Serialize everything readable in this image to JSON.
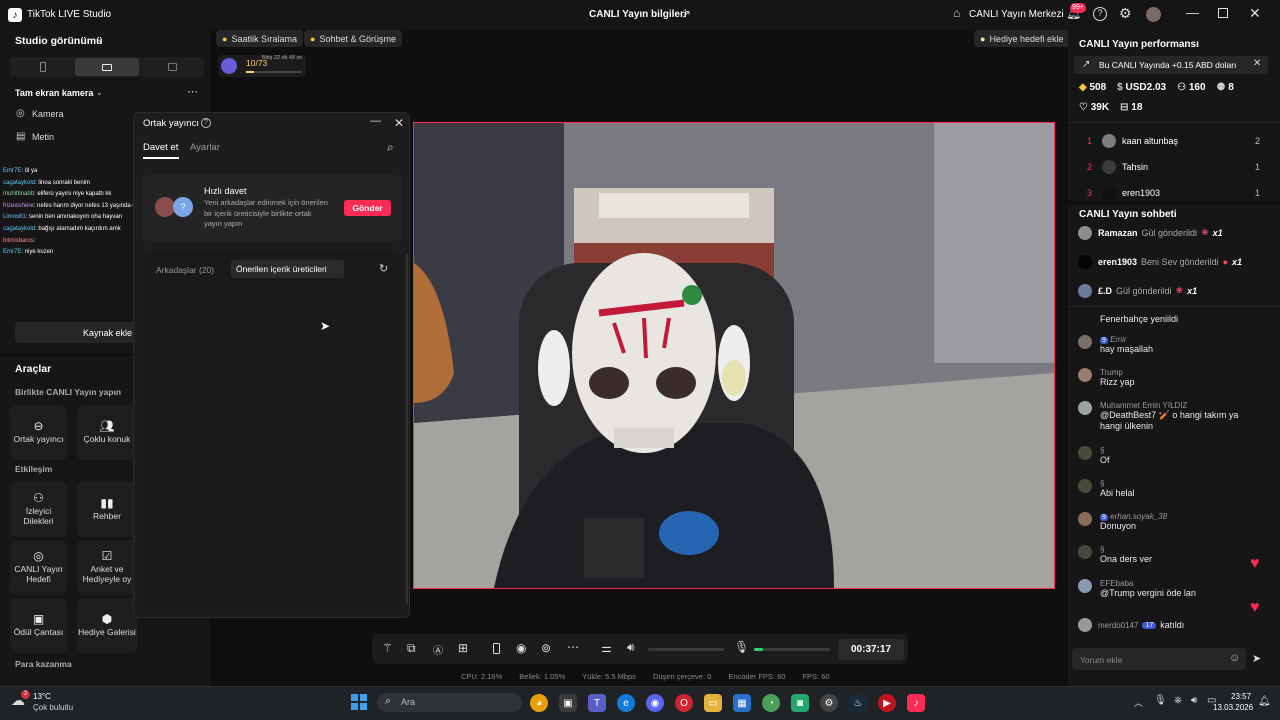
{
  "titlebar": {
    "app": "TikTok LIVE Studio",
    "center": "CANLI Yayın bilgileri",
    "center_link": "CANLI Yayın Merkezi",
    "badge": "99+"
  },
  "left": {
    "studio_view": "Studio görünümü",
    "fullscreen_camera": "Tam ekran kamera",
    "sources": [
      {
        "label": "Kamera",
        "icon": "camera-icon"
      },
      {
        "label": "Metin",
        "icon": "text-icon"
      }
    ],
    "chat_overlay": [
      {
        "user": "Emr7E",
        "text": ": öl ya",
        "color": "#5ec8ff"
      },
      {
        "user": "cagataykold",
        "text": ": linoa sonraki benim",
        "color": "#5ec8ff"
      },
      {
        "user": "muhittinabb",
        "text": ": elifero yayını niye kapattı kk",
        "color": "#7bd88f"
      },
      {
        "user": "frizexishere",
        "text": ": nefes harım diyor nefes 13 yaşında çocuk",
        "color": "#c69bff"
      },
      {
        "user": "Limos61",
        "text": ": senin ben amınakoyım oha hayvan",
        "color": "#5ec8ff"
      },
      {
        "user": "cagataykold",
        "text": ": bağışı atamadım kaçırdım amk",
        "color": "#5ec8ff"
      },
      {
        "user": "bitmisbaros",
        "text": ":",
        "color": "#ff8a8a"
      },
      {
        "user": "Emr7E",
        "text": ": niye kuzen",
        "color": "#5ec8ff"
      }
    ],
    "add_source": "Kaynak ekle",
    "tools_title": "Araçlar",
    "together_title": "Birlikte CANLI Yayın yapın",
    "together_tools": [
      "Ortak yayıncı",
      "Çoklu konuk"
    ],
    "interaction_title": "Etkileşim",
    "interaction_tools": [
      "İzleyici Dilekleri",
      "Rehber",
      "CANLI Yayın Hedefi",
      "Anket ve Hediyeyle oy",
      "Ödül Çantası",
      "Hediye Galerisi"
    ],
    "money_title": "Para kazanma"
  },
  "center": {
    "chips": [
      "Saatlik Sıralama",
      "Sohbet & Görüşme"
    ],
    "gift_goal": "Hediye hedefi ekle",
    "progress_text": "10/73",
    "progress_fraction": 0.137,
    "progress_time": "Bitiş 22 dk 48 sn",
    "timer": "00:37:17",
    "volume_level": 0.12,
    "stats": [
      "CPU: 2.16%",
      "Bellek: 1.05%",
      "Yükle: 5.5 Mbps",
      "Düşen çerçeve: 0",
      "Encoder FPS: 60",
      "FPS: 60"
    ]
  },
  "cohost": {
    "title": "Ortak yayıncı",
    "tabs": [
      "Davet et",
      "Ayarlar"
    ],
    "quick_title": "Hızlı davet",
    "quick_desc": "Yeni arkadaşlar edinmek için önerilen bir içerik üreticisiyle birlikte ortak yayın yapın",
    "send": "Gönder",
    "friends_tab": "Arkadaşlar (20)",
    "suggested_tab": "Önerilen içerik üreticileri"
  },
  "right": {
    "perf_title": "CANLI Yayın performansı",
    "banner": "Bu CANLI Yayında +0.15 ABD doları",
    "stats": [
      {
        "icon": "diamond-icon",
        "value": "508"
      },
      {
        "icon": "coin-icon",
        "value": "USD2.03"
      },
      {
        "icon": "viewers-icon",
        "value": "160"
      },
      {
        "icon": "users-icon",
        "value": "8"
      },
      {
        "icon": "heart-icon",
        "value": "39K"
      },
      {
        "icon": "gift-icon",
        "value": "18"
      }
    ],
    "ranking": [
      {
        "rank": "1",
        "name": "kaan altunbaş",
        "count": "2"
      },
      {
        "rank": "2",
        "name": "Tahsin",
        "count": "1"
      },
      {
        "rank": "3",
        "name": "eren1903",
        "count": "1"
      }
    ],
    "chat_title": "CANLI Yayın sohbeti",
    "gifts": [
      {
        "name": "Ramazan",
        "text": "Gül gönderildi",
        "mult": "x1"
      },
      {
        "name": "eren1903",
        "text": "Beni Sev gönderildi",
        "mult": "x1"
      },
      {
        "name": "£.D",
        "text": "Gül gönderildi",
        "mult": "x1"
      }
    ],
    "partial_msg": "Fenerbahçe yeniildi",
    "messages": [
      {
        "name": "Emir",
        "badge": "9",
        "text": "hay maşallah"
      },
      {
        "name": "Trump",
        "badge": "",
        "text": "Rizz yap"
      },
      {
        "name": "Muhammet Emin YILDIZ",
        "badge": "",
        "text": "@DeathBest7 🏏 o hangi takım ya hangi ülkenin"
      },
      {
        "name": "§",
        "badge": "",
        "text": "Of"
      },
      {
        "name": "§",
        "badge": "",
        "text": "Abi helal"
      },
      {
        "name": "erhan.soyak_38",
        "badge": "9",
        "text": "Donuyon"
      },
      {
        "name": "§",
        "badge": "",
        "text": "Ona ders ver"
      },
      {
        "name": "EFEbaba",
        "badge": "",
        "text": "@Trump vergini öde lan"
      }
    ],
    "join": {
      "name": "merdo0147",
      "badge": "17",
      "text": "katıldı"
    },
    "comment_placeholder": "Yorum ekle"
  },
  "taskbar": {
    "weather_temp": "13°C",
    "weather_desc": "Çok bulutlu",
    "weather_badge": "2",
    "search": "Ara",
    "time": "23:57",
    "date": "13.03.2026"
  }
}
